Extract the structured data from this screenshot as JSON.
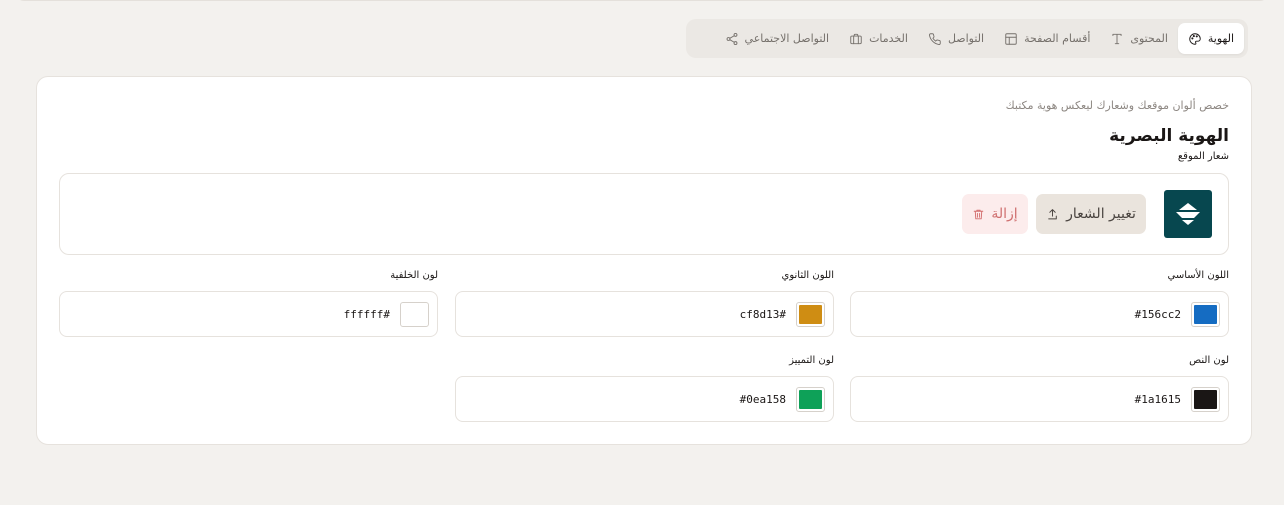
{
  "tabs": [
    {
      "label": "الهوية",
      "icon": "palette-icon",
      "active": true
    },
    {
      "label": "المحتوى",
      "icon": "type-icon",
      "active": false
    },
    {
      "label": "أقسام الصفحة",
      "icon": "layout-icon",
      "active": false
    },
    {
      "label": "التواصل",
      "icon": "phone-icon",
      "active": false
    },
    {
      "label": "الخدمات",
      "icon": "briefcase-icon",
      "active": false
    },
    {
      "label": "التواصل الاجتماعي",
      "icon": "share-icon",
      "active": false
    }
  ],
  "identity": {
    "subtitle": "خصص ألوان موقعك وشعارك ليعكس هوية مكتبك",
    "title": "الهوية البصرية",
    "logo_label": "شعار الموقع",
    "logo_color": "#07474f",
    "change_logo": "تغيير الشعار",
    "remove_logo": "إزالة"
  },
  "colors": {
    "primary": {
      "label": "اللون الأساسي",
      "value": "#156cc2",
      "display": "#156cc2"
    },
    "secondary": {
      "label": "اللون الثانوي",
      "value": "#cf8d13",
      "display": "#cf8d13"
    },
    "background": {
      "label": "لون الخلفية",
      "value": "#ffffff",
      "display": "#ffffff"
    },
    "text": {
      "label": "لون النص",
      "value": "#1a1615",
      "display": "#1a1615"
    },
    "accent": {
      "label": "لون التمييز",
      "value": "#0ea158",
      "display": "#0ea158"
    }
  }
}
